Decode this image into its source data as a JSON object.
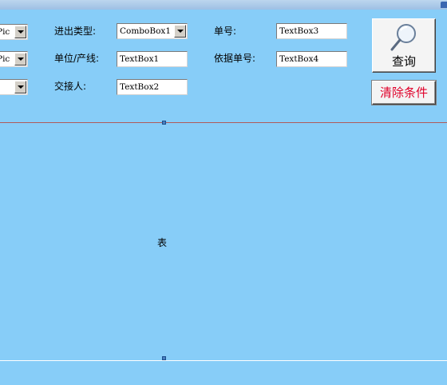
{
  "form": {
    "left_combo_1": "Pic",
    "left_combo_2": "Pic",
    "left_combo_3": "",
    "type_label": "进出类型:",
    "type_combo": "ComboBox1",
    "unit_label": "单位/产线:",
    "unit_value": "TextBox1",
    "handover_label": "交接人:",
    "handover_value": "TextBox2",
    "order_label": "单号:",
    "order_value": "TextBox3",
    "basis_label": "依据单号:",
    "basis_value": "TextBox4"
  },
  "buttons": {
    "query_label": "查询",
    "clear_label": "清除条件"
  },
  "table": {
    "label": "表"
  },
  "colors": {
    "background": "#87cdf8",
    "clear_text": "#e0002a"
  },
  "icons": {
    "query": "magnifier-icon"
  }
}
